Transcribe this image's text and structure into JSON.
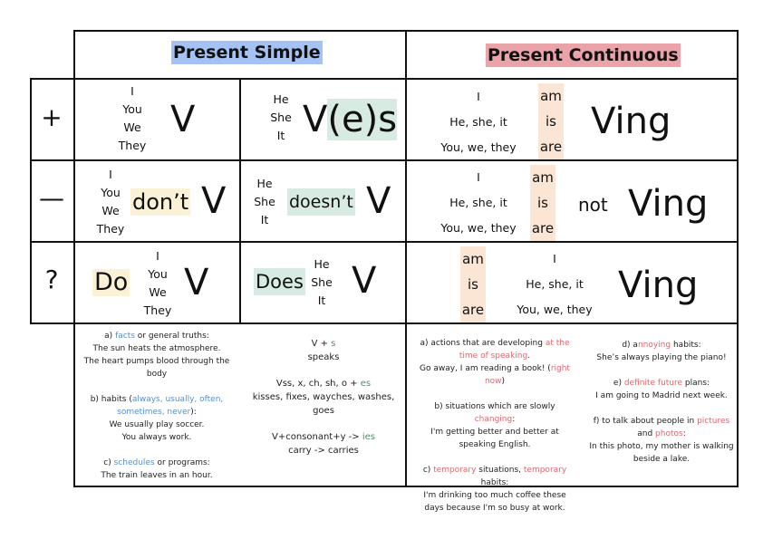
{
  "colors": {
    "simple_header_bg": "#a4c2f4",
    "continuous_header_bg": "#eaa3a8",
    "dont_do_bg": "#fbf1d6",
    "does_bg": "#d7ebe2",
    "be_bg": "#fbe6d6",
    "simple_accent": "#5b8fc8",
    "spelling_accent": "#4f8f6f",
    "continuous_accent": "#d96a72"
  },
  "headers": {
    "present_simple": "Present Simple",
    "present_continuous": "Present Continuous"
  },
  "row_symbols": {
    "positive": "+",
    "negative": "—",
    "question": "?"
  },
  "pronouns": {
    "plural_group": [
      "I",
      "You",
      "We",
      "They"
    ],
    "third_person": [
      "He",
      "She",
      "It"
    ],
    "continuous_group": [
      "I",
      "He, she, it",
      "You, we, they"
    ]
  },
  "be_forms": [
    "am",
    "is",
    "are"
  ],
  "positive": {
    "simple_plural_verb": "V",
    "simple_third_verb_base": "V",
    "simple_third_verb_suffix": "(e)s",
    "continuous_verb": "Ving"
  },
  "negative": {
    "simple_plural_aux": "don’t",
    "simple_plural_verb": "V",
    "simple_third_aux": "doesn’t",
    "simple_third_verb": "V",
    "continuous_not": "not",
    "continuous_verb": "Ving"
  },
  "question": {
    "simple_plural_aux": "Do",
    "simple_plural_verb": "V",
    "simple_third_aux": "Does",
    "simple_third_verb": "V",
    "continuous_verb": "Ving"
  },
  "notes": {
    "simple_uses": {
      "a_pre": "a) ",
      "a_hl": "facts",
      "a_post": " or general truths:",
      "a_ex1": "The sun heats the atmosphere.",
      "a_ex2": "The heart pumps blood through the body",
      "b_pre": "b) habits (",
      "b_hl": "always, usually, often, sometimes, never",
      "b_post": "):",
      "b_ex1": "We usually play soccer.",
      "b_ex2": "You always work.",
      "c_pre": "c) ",
      "c_hl": "schedules",
      "c_post": " or programs:",
      "c_ex1": "The train leaves in an hour."
    },
    "simple_spelling": {
      "r1_pre": "V + ",
      "r1_hl": "s",
      "r1_ex": "speaks",
      "r2_pre": "Vss, x, ch, sh, o + ",
      "r2_hl": "es",
      "r2_ex": "kisses, fixes, wayches, washes, goes",
      "r3_pre": "V+consonant+y -> ",
      "r3_hl": "ies",
      "r3_ex": "carry -> carries"
    },
    "continuous_uses_left": {
      "a_pre": "a) actions that are developing ",
      "a_hl": "at the time of speaking",
      "a_post": ".",
      "a_ex_pre": "Go away, I am reading a book! (",
      "a_ex_hl": "right now",
      "a_ex_post": ")",
      "b_pre": "b) situations which are slowly ",
      "b_hl": "changing",
      "b_post": ":",
      "b_ex": "I'm getting better and better at speaking English.",
      "c_pre": "c) ",
      "c_hl1": "temporary",
      "c_mid": " situations, ",
      "c_hl2": "temporary",
      "c_post": " habits:",
      "c_ex": "I'm drinking too much coffee these days because I'm so busy at work."
    },
    "continuous_uses_right": {
      "d_pre": "d) a",
      "d_hl": "nnoying",
      "d_post": " habits:",
      "d_ex": "She’s always playing the piano!",
      "e_pre": "e) ",
      "e_hl": "definite future",
      "e_post": " plans:",
      "e_ex": "I am going to Madrid next week.",
      "f_pre": "f) to talk about people in ",
      "f_hl1": "pictures",
      "f_mid": " and ",
      "f_hl2": "photos",
      "f_post": ":",
      "f_ex": "In this photo, my mother is walking beside a lake."
    }
  }
}
